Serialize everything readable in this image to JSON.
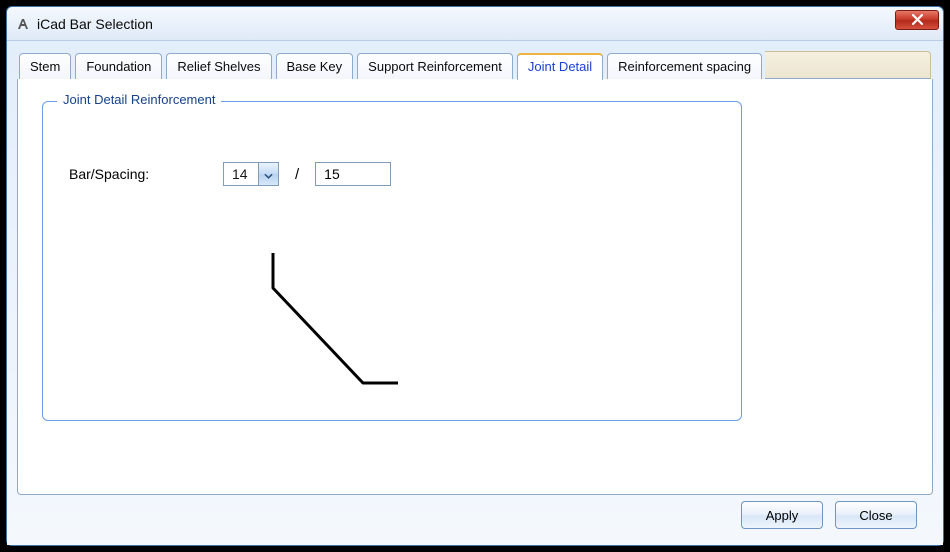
{
  "window": {
    "title": "iCad Bar Selection"
  },
  "tabs": [
    {
      "id": "stem",
      "label": "Stem"
    },
    {
      "id": "foundation",
      "label": "Foundation"
    },
    {
      "id": "relief",
      "label": "Relief Shelves"
    },
    {
      "id": "basekey",
      "label": "Base Key"
    },
    {
      "id": "support",
      "label": "Support Reinforcement"
    },
    {
      "id": "joint",
      "label": "Joint Detail",
      "active": true
    },
    {
      "id": "spacing",
      "label": "Reinforcement spacing"
    }
  ],
  "group": {
    "title": "Joint Detail Reinforcement",
    "field_label": "Bar/Spacing:",
    "bar_value": "14",
    "spacing_value": "15"
  },
  "buttons": {
    "apply": "Apply",
    "close": "Close"
  }
}
